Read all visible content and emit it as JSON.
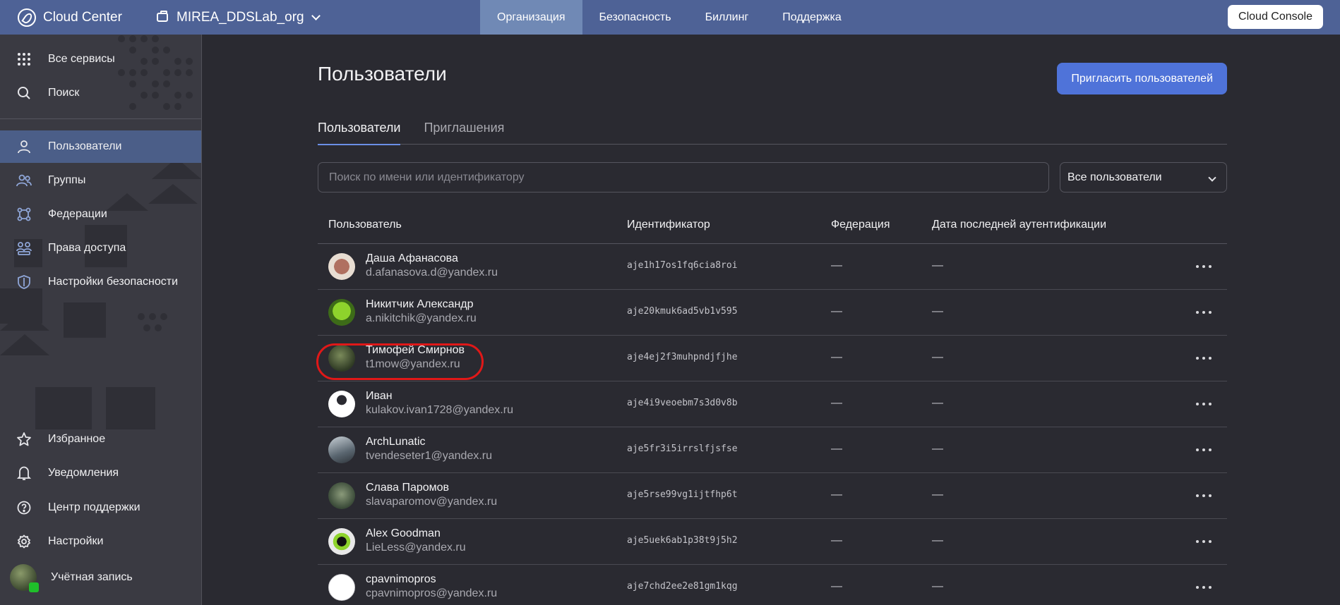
{
  "header": {
    "brand": "Cloud Center",
    "org_name": "MIREA_DDSLab_org",
    "nav": [
      "Организация",
      "Безопасность",
      "Биллинг",
      "Поддержка"
    ],
    "active_nav": "Организация",
    "console_button": "Cloud Console"
  },
  "sidebar": {
    "top_items": [
      {
        "label": "Все сервисы",
        "icon": "grid-icon"
      },
      {
        "label": "Поиск",
        "icon": "search-icon"
      }
    ],
    "items": [
      {
        "label": "Пользователи",
        "icon": "user-icon",
        "active": true
      },
      {
        "label": "Группы",
        "icon": "users-icon"
      },
      {
        "label": "Федерации",
        "icon": "federation-icon"
      },
      {
        "label": "Права доступа",
        "icon": "access-rights-icon"
      },
      {
        "label": "Настройки безопасности",
        "icon": "shield-icon"
      }
    ],
    "bottom_items": [
      {
        "label": "Избранное",
        "icon": "star-icon"
      },
      {
        "label": "Уведомления",
        "icon": "bell-icon"
      },
      {
        "label": "Центр поддержки",
        "icon": "help-icon"
      },
      {
        "label": "Настройки",
        "icon": "gear-icon"
      },
      {
        "label": "Учётная запись",
        "icon": "account-avatar"
      }
    ]
  },
  "main": {
    "title": "Пользователи",
    "invite_button": "Пригласить пользователей",
    "tabs": [
      "Пользователи",
      "Приглашения"
    ],
    "active_tab": "Пользователи",
    "search_placeholder": "Поиск по имени или идентификатору",
    "filter_value": "Все пользователи",
    "columns": [
      "Пользователь",
      "Идентификатор",
      "Федерация",
      "Дата последней аутентификации"
    ],
    "rows": [
      {
        "name": "Даша Афанасова",
        "email": "d.afanasova.d@yandex.ru",
        "id": "aje1h17os1fq6cia8roi",
        "federation": "—",
        "last_auth": "—"
      },
      {
        "name": "Никитчик Александр",
        "email": "a.nikitchik@yandex.ru",
        "id": "aje20kmuk6ad5vb1v595",
        "federation": "—",
        "last_auth": "—"
      },
      {
        "name": "Тимофей Смирнов",
        "email": "t1mow@yandex.ru",
        "id": "aje4ej2f3muhpndjfjhe",
        "federation": "—",
        "last_auth": "—",
        "highlighted": true
      },
      {
        "name": "Иван",
        "email": "kulakov.ivan1728@yandex.ru",
        "id": "aje4i9veoebm7s3d0v8b",
        "federation": "—",
        "last_auth": "—"
      },
      {
        "name": "ArchLunatic",
        "email": "tvendeseter1@yandex.ru",
        "id": "aje5fr3i5irrslfjsfse",
        "federation": "—",
        "last_auth": "—"
      },
      {
        "name": "Слава Паромов",
        "email": "slavaparomov@yandex.ru",
        "id": "aje5rse99vg1ijtfhp6t",
        "federation": "—",
        "last_auth": "—"
      },
      {
        "name": "Alex Goodman",
        "email": "LieLess@yandex.ru",
        "id": "aje5uek6ab1p38t9j5h2",
        "federation": "—",
        "last_auth": "—"
      },
      {
        "name": "cpavnimopros",
        "email": "cpavnimopros@yandex.ru",
        "id": "aje7chd2ee2e81gm1kqg",
        "federation": "—",
        "last_auth": "—"
      }
    ]
  }
}
